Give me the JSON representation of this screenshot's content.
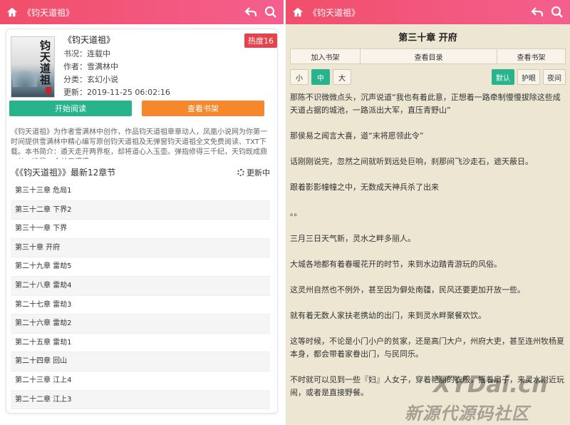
{
  "left": {
    "header_title": "《钧天道祖》",
    "book": {
      "name": "《钧天道祖》",
      "cover_title": "钧天道祖",
      "status": "书况：连载中",
      "author": "作者：雪满林中",
      "category": "分类：玄幻小说",
      "updated": "更新：2019-11-25 06:02:16",
      "hot_badge": "热度16"
    },
    "buttons": {
      "start_read": "开始阅读",
      "add_shelf": "查看书架"
    },
    "intro": "《钧天道祖》为作者雪满林中创作，作品钧天道祖章章动人，凤凰小说网为你第一时间提供雪满林中精心编写原创钧天道祖及无弹窗钧天道祖全文免费阅读、TXT下载。本书简介：遁天走开两界枢，却将道心入玉壶。弹指修得三千纪，天钧既成鼎一炉。这是一个关于漫漫",
    "latest_heading": "《《钧天道祖》》最新12章节",
    "updating": "更新中",
    "chapters": [
      "第三十三章 危局1",
      "第三十二章 下界2",
      "第三十一章 下界",
      "第三十章 开府",
      "第二十九章 雷劫5",
      "第二十八章 雷劫4",
      "第二十七章 雷劫3",
      "第二十六章 雷劫2",
      "第二十五章 雷劫1",
      "第二十四章 回山",
      "第二十三章 江上4",
      "第二十二章 江上3"
    ]
  },
  "right": {
    "header_title": "《钧天道祖》",
    "chapter_title": "第三十章 开府",
    "tools": [
      "加入书架",
      "查看目录",
      "查看书架"
    ],
    "sizes": [
      "小",
      "中",
      "大"
    ],
    "size_selected": "中",
    "themes": [
      "默认",
      "护眼",
      "夜间"
    ],
    "theme_selected": "默认",
    "paragraphs": [
      "那陈不识微微点头，沉声说道“我也有着此意，正想着一路牵制慢慢拔除这些成天道占据的城池，一路派出大军，直压青野山”",
      "那侯易之闻言大喜，道“末将愿领此令”",
      "话刚刚说完，忽然之间就听到远处巨响，刹那间飞沙走石，遮天蔽日。",
      "跟着影影幢幢之中，无数成天神兵杀了出来",
      "。。",
      "三月三日天气新，灵水之畔多丽人。",
      "大城各地都有着春暖花开的时节，来到水边踏青游玩的风俗。",
      "这灵州自然也不例外，甚至因为僻处南疆，民风还要更加开放一些。",
      "就有着无数人家扶老携幼的出门，来到灵水畔聚餐欢饮。",
      "这等时候，不论是小门小户的贫家，还是高门大户，州府大吏，甚至连州牧杨夏本身，都会带着家眷出门，与民同乐。",
      "不时就可以见到一些『妇』人女子，穿着艳丽的衣服，摇着扇子，来灵水附近玩闹，或者是直接野餐。"
    ]
  },
  "watermark": {
    "line1": "XYDai.cn",
    "line2": "新源代源码社区"
  },
  "colors": {
    "header": "#f14e6a",
    "green": "#27b48d",
    "orange": "#f5882b",
    "hot": "#e6424b",
    "paper": "#ede6d3"
  }
}
